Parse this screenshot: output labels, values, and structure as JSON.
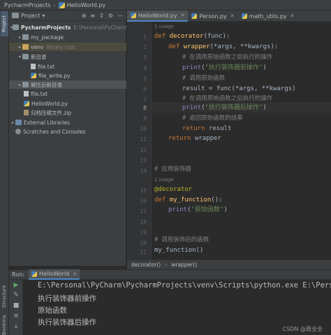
{
  "titlebar": {
    "project": "PycharmProjects",
    "file": "HelloWorld.py"
  },
  "left_strip": {
    "project_tab": "Project",
    "structure_tab": "Structure",
    "bookmarks_tab": "Bookmarks"
  },
  "project_panel": {
    "title": "Project",
    "tree": {
      "root": "PycharmProjects",
      "root_path": "E:\\Personal\\PyCharm\\Pyc",
      "my_package": "my_package",
      "venv": "venv",
      "venv_note": "library root",
      "new_dir": "新目录",
      "file_txt_1": "file.txt",
      "file_write": "file_write.py",
      "unzip_dir": "解压后新目录",
      "file_txt_2": "file.txt",
      "helloworld": "HelloWorld.py",
      "zip_file": "归档压缩文件.zip",
      "external_libs": "External Libraries",
      "scratches": "Scratches and Consoles"
    }
  },
  "editor": {
    "tabs": [
      {
        "label": "HelloWorld.py",
        "active": true
      },
      {
        "label": "Person.py",
        "active": false
      },
      {
        "label": "math_utils.py",
        "active": false
      }
    ],
    "hints": {
      "usage": "1 usage"
    },
    "line_numbers": [
      "1",
      "2",
      "3",
      "4",
      "5",
      "6",
      "7",
      "8",
      "9",
      "10",
      "11",
      "12",
      "13",
      "14",
      "15",
      "16",
      "17",
      "18",
      "19",
      "20",
      "21",
      "22"
    ],
    "current_line": "8",
    "code": {
      "l1_kw": "def ",
      "l1_fn": "decorator",
      "l1_rest": "(func):",
      "l2_kw": "def ",
      "l2_fn": "wrapper",
      "l2_rest": "(*args, **kwargs):",
      "l3": "# 在调用原始函数之前执行的操作",
      "l4_bi": "print",
      "l4_a": "(",
      "l4_str": "\"执行装饰器前操作\"",
      "l4_b": ")",
      "l5": "# 调用原始函数",
      "l6": "result = func(*args, **kwargs)",
      "l7": "# 在调用原始函数之后执行的操作",
      "l8_bi": "print",
      "l8_a": "(",
      "l8_str": "\"执行装饰器后操作\"",
      "l8_b": ")",
      "l9": "# 返回原始函数的结果",
      "l10_kw": "return ",
      "l10_rest": "result",
      "l11_kw": "return ",
      "l11_rest": "wrapper",
      "l14": "# 应用装饰器",
      "l15": "@decorator",
      "l16_kw": "def ",
      "l16_fn": "my_function",
      "l16_rest": "():",
      "l17_bi": "print",
      "l17_a": "(",
      "l17_str": "\"原始函数\"",
      "l17_b": ")",
      "l20": "# 调用装饰后的函数",
      "l21": "my_function()"
    },
    "breadcrumb": [
      "decorator()",
      "wrapper()"
    ]
  },
  "run_panel": {
    "label": "Run:",
    "tab": "HelloWorld",
    "output": [
      "E:\\Personal\\PyCharm\\PycharmProjects\\venv\\Scripts\\python.exe E:\\Perso",
      "执行装饰器前操作",
      "原始函数",
      "执行装饰器后操作"
    ]
  },
  "watermark": "CSDN @周全全",
  "colors": {
    "accent": "#4a88c7",
    "bg": "#2b2b2b",
    "panel": "#3c3f41",
    "keyword": "#cc7832",
    "string": "#6a8759",
    "comment": "#808080",
    "function": "#ffc66d"
  }
}
